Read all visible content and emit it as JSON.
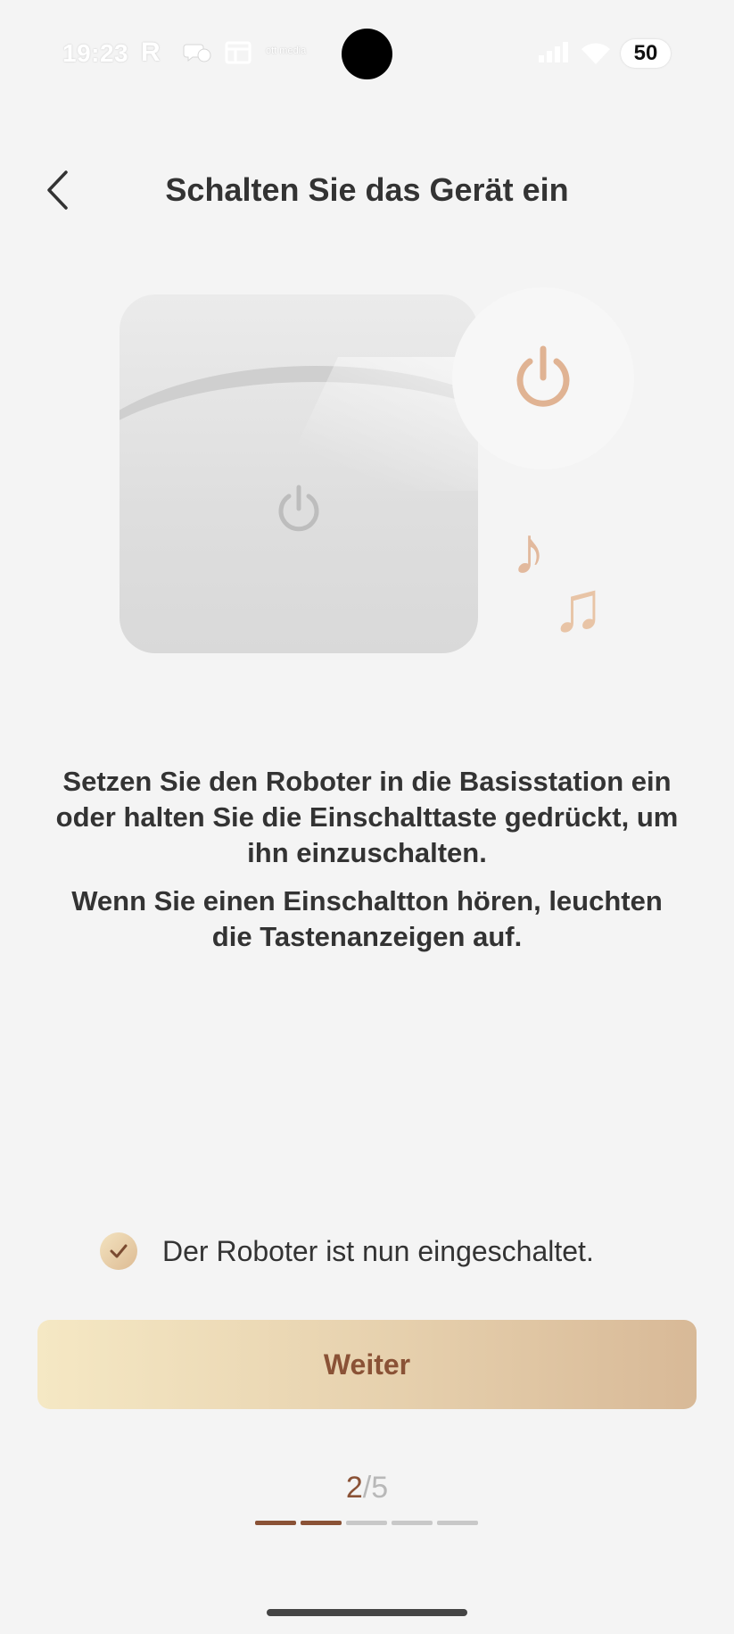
{
  "status_bar": {
    "time": "19:23",
    "app_icon_letter": "R",
    "small_icon_text": "ott media",
    "battery_level": "50",
    "icons": [
      "r-app-icon",
      "chat-icon",
      "news-icon",
      "signal-icon",
      "wifi-icon",
      "battery-icon"
    ]
  },
  "header": {
    "title": "Schalten Sie das Gerät ein",
    "back_icon": "chevron-left-icon"
  },
  "illustration": {
    "device_icon": "power-icon",
    "bubble_icon": "power-icon",
    "note_icons": [
      "music-note-icon",
      "music-notes-icon"
    ],
    "accent_color": "#e0b393"
  },
  "instructions": {
    "paragraph1": "Setzen Sie den Roboter in die Basisstation ein oder halten Sie die Einschalttaste gedrückt, um ihn einzuschalten.",
    "paragraph2": "Wenn Sie einen Einschaltton hören, leuchten die Tastenanzeigen auf."
  },
  "confirmation": {
    "checked": true,
    "label": "Der Roboter ist nun eingeschaltet."
  },
  "primary_button": {
    "label": "Weiter",
    "text_color": "#8a5236"
  },
  "pager": {
    "current": "2",
    "separator": "/",
    "total": "5",
    "steps_total": 5,
    "steps_done": 2,
    "active_color": "#8a5236"
  }
}
